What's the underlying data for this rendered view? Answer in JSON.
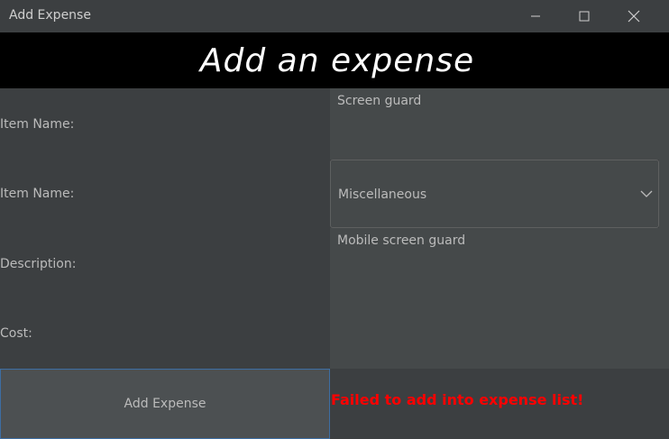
{
  "window": {
    "title": "Add Expense",
    "controls": {
      "minimize": "minimize-icon",
      "maximize": "maximize-icon",
      "close": "close-icon"
    }
  },
  "header": {
    "title": "Add an expense"
  },
  "form": {
    "item_name_label": "Item Name:",
    "item_name_value": "Screen guard",
    "category_label": "Item Name:",
    "category_value": "Miscellaneous",
    "description_label": "Description:",
    "description_value": "Mobile screen guard",
    "cost_label": "Cost:",
    "cost_value": ""
  },
  "actions": {
    "add_button": "Add Expense"
  },
  "status": {
    "message": "Failed to add into expense list!",
    "color": "#ff0000"
  }
}
